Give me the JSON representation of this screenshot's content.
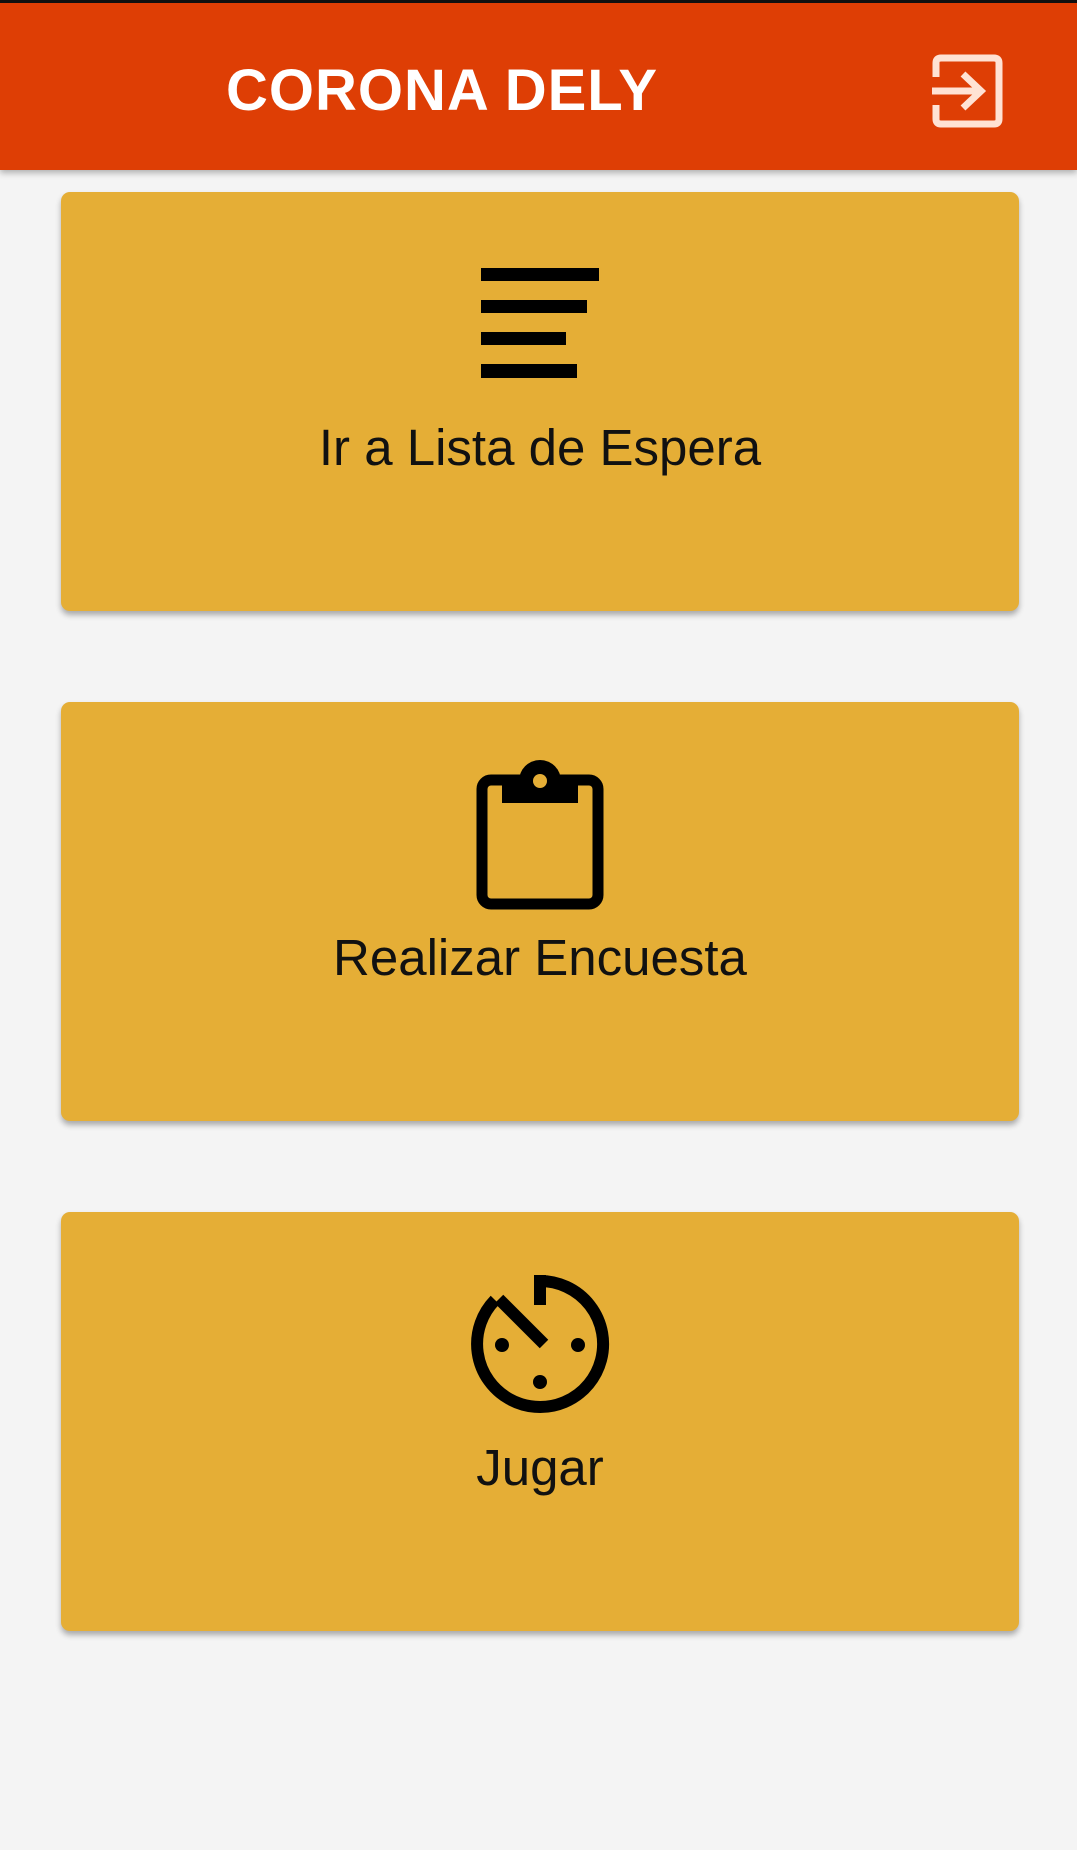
{
  "app_bar": {
    "title": "CORONA DELY",
    "background_color": "#de3e05",
    "logout_icon": "login-arrow-box-icon"
  },
  "cards": [
    {
      "label": "Ir a Lista de Espera",
      "icon": "sort-lines-icon"
    },
    {
      "label": "Realizar Encuesta",
      "icon": "clipboard-icon"
    },
    {
      "label": "Jugar",
      "icon": "game-timer-icon"
    }
  ],
  "colors": {
    "card_background": "#e5ae36",
    "page_background": "#f4f4f4",
    "icon_color": "#000000"
  }
}
